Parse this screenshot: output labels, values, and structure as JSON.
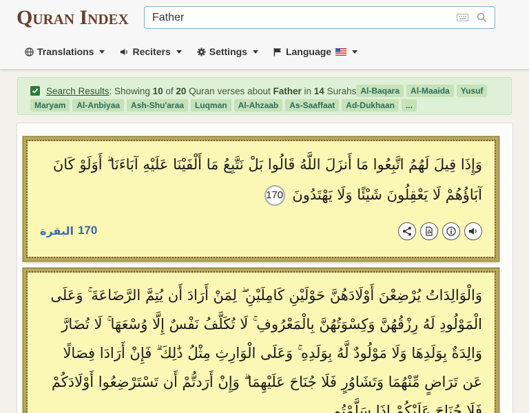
{
  "header": {
    "logo": "Quran Index",
    "search": {
      "value": "Father",
      "placeholder": ""
    },
    "nav": [
      {
        "label": "Translations",
        "icon": "globe-icon"
      },
      {
        "label": "Reciters",
        "icon": "speaker-icon"
      },
      {
        "label": "Settings",
        "icon": "gear-icon"
      },
      {
        "label": "Language",
        "icon": "flag-icon"
      }
    ]
  },
  "results": {
    "link": "Search Results",
    "text_showing": ": Showing ",
    "count": "10",
    "text_of": " of ",
    "total": "20",
    "text_about": " Quran verses about ",
    "term": "Father",
    "text_in": " in ",
    "surah_count": "14",
    "text_surahs": " Surahs",
    "tags": [
      "Al-Baqara",
      "Al-Maaida",
      "Yusuf",
      "Maryam",
      "Al-Anbiyaa",
      "Ash-Shu'araa",
      "Luqman",
      "Al-Ahzaab",
      "As-Saaffaat",
      "Ad-Dukhaan",
      "..."
    ]
  },
  "verses": [
    {
      "arabic": "وَإِذَا قِيلَ لَهُمُ اتَّبِعُوا مَا أَنزَلَ اللَّهُ قَالُوا بَلْ نَتَّبِعُ مَا أَلْفَيْنَا عَلَيْهِ آبَاءَنَا ۗ أَوَلَوْ كَانَ آبَاؤُهُمْ لَا يَعْقِلُونَ شَيْئًا وَلَا يَهْتَدُونَ",
      "number": "170",
      "surah_name": "البقرة",
      "surah_number": "170"
    },
    {
      "arabic": "وَالْوَالِدَاتُ يُرْضِعْنَ أَوْلَادَهُنَّ حَوْلَيْنِ كَامِلَيْنِ ۖ لِمَنْ أَرَادَ أَن يُتِمَّ الرَّضَاعَةَ ۚ وَعَلَى الْمَوْلُودِ لَهُ رِزْقُهُنَّ وَكِسْوَتُهُنَّ بِالْمَعْرُوفِ ۚ لَا تُكَلَّفُ نَفْسٌ إِلَّا وُسْعَهَا ۚ لَا تُضَارَّ وَالِدَةٌ بِوَلَدِهَا وَلَا مَوْلُودٌ لَّهُ بِوَلَدِهِ ۚ وَعَلَى الْوَارِثِ مِثْلُ ذَٰلِكَ ۗ فَإِنْ أَرَادَا فِصَالًا عَن تَرَاضٍ مِّنْهُمَا وَتَشَاوُرٍ فَلَا جُنَاحَ عَلَيْهِمَا ۗ وَإِنْ أَرَدتُّمْ أَن تَسْتَرْضِعُوا أَوْلَادَكُمْ فَلَا جُنَاحَ عَلَيْكُمْ إِذَا سَلَّمْتُم"
    }
  ]
}
